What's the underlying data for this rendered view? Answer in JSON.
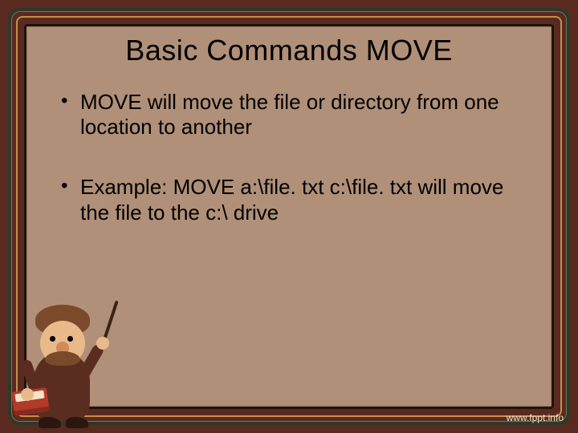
{
  "slide": {
    "title": "Basic Commands MOVE",
    "bullets": [
      "MOVE will move the file or directory from one location to another",
      "Example: MOVE a:\\file. txt c:\\file. txt will move the file to the c:\\ drive"
    ]
  },
  "footer": {
    "link": "www.fppt.info"
  }
}
